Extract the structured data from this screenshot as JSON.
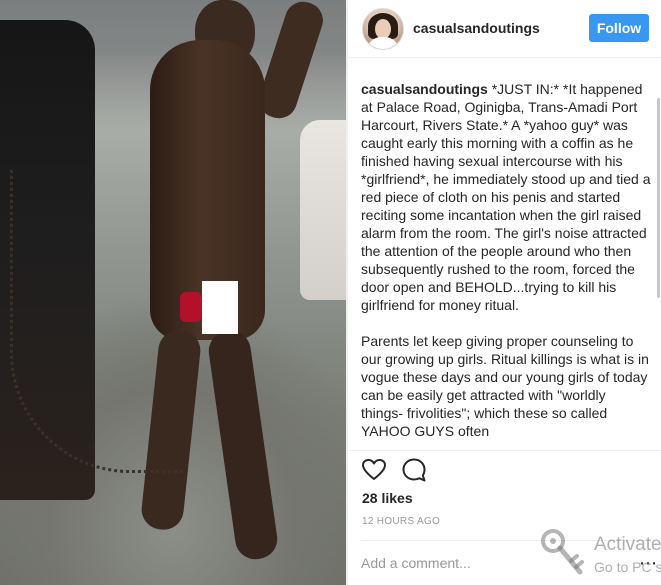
{
  "post": {
    "username": "casualsandoutings",
    "follow_label": "Follow",
    "caption_username": "casualsandoutings",
    "caption_paragraphs": [
      "*JUST IN:* *It happened at Palace Road, Oginigba, Trans-Amadi Port Harcourt, Rivers State.* A *yahoo guy* was caught early this morning with a coffin as he finished having sexual intercourse with his *girlfriend*, he immediately stood up and tied a red piece of cloth on his penis and started reciting some incantation when the girl raised alarm from the room. The girl's noise attracted the attention of the people around who then subsequently rushed to the room, forced the door open and BEHOLD...trying to kill his girlfriend for money ritual.",
      "Parents let keep giving proper counseling to our growing up girls. Ritual killings is what is in vogue these days and our young girls of today can be easily get attracted with \"worldly things- frivolities\"; which these so called YAHOO GUYS often"
    ],
    "likes": "28 likes",
    "timestamp": "12 HOURS AGO",
    "comment_placeholder": "Add a comment...",
    "options_icon": "ellipsis-icon",
    "icons": [
      "heart-icon",
      "comment-icon"
    ],
    "accent_color": "#3897f0"
  },
  "watermark": {
    "title": "Activate",
    "subtitle": "Go to PC s"
  }
}
